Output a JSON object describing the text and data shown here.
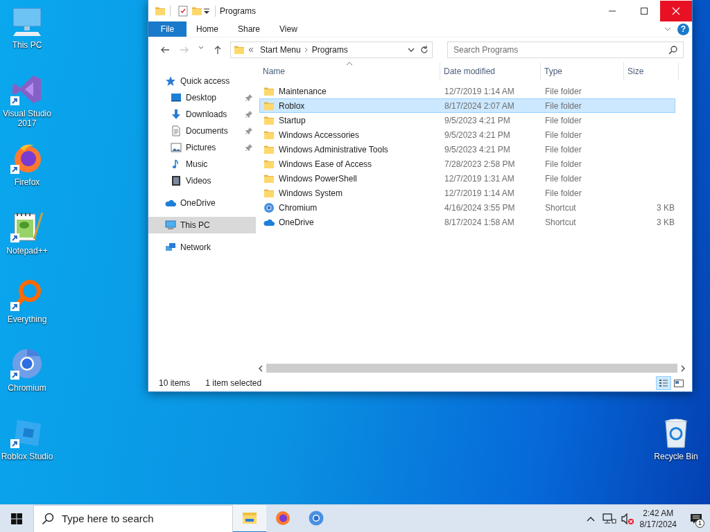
{
  "desktop_icons": [
    {
      "label": "This PC",
      "kind": "pc",
      "shortcut": false
    },
    {
      "label": "Visual Studio 2017",
      "kind": "vs",
      "shortcut": true
    },
    {
      "label": "Firefox",
      "kind": "firefox",
      "shortcut": true
    },
    {
      "label": "Notepad++",
      "kind": "notepad",
      "shortcut": true
    },
    {
      "label": "Everything",
      "kind": "everything",
      "shortcut": true
    },
    {
      "label": "Chromium",
      "kind": "chromium",
      "shortcut": true
    },
    {
      "label": "Roblox Studio",
      "kind": "roblox",
      "shortcut": true
    }
  ],
  "recycle_bin": {
    "label": "Recycle Bin"
  },
  "window": {
    "title": "Programs",
    "ribbon_tabs": [
      {
        "label": "File",
        "kind": "file"
      },
      {
        "label": "Home",
        "kind": "tab"
      },
      {
        "label": "Share",
        "kind": "tab"
      },
      {
        "label": "View",
        "kind": "tab"
      }
    ],
    "help": "?",
    "nav_buttons": [
      {
        "kind": "back",
        "disabled": false
      },
      {
        "kind": "forward",
        "disabled": true
      },
      {
        "kind": "recent",
        "disabled": false
      },
      {
        "kind": "up",
        "disabled": false
      }
    ],
    "breadcrumb": [
      "Start Menu",
      "Programs"
    ],
    "search": {
      "placeholder": "Search Programs"
    },
    "nav_pane": [
      {
        "label": "Quick access",
        "kind": "star",
        "selected": false,
        "children": [
          {
            "label": "Desktop",
            "kind": "desktop",
            "pinned": true,
            "selected": false
          },
          {
            "label": "Downloads",
            "kind": "download",
            "pinned": true,
            "selected": false
          },
          {
            "label": "Documents",
            "kind": "document",
            "pinned": true,
            "selected": false
          },
          {
            "label": "Pictures",
            "kind": "picture",
            "pinned": true,
            "selected": false
          },
          {
            "label": "Music",
            "kind": "music",
            "pinned": false,
            "selected": false
          },
          {
            "label": "Videos",
            "kind": "video",
            "pinned": false,
            "selected": false
          }
        ]
      },
      {
        "label": "OneDrive",
        "kind": "onedrive",
        "selected": false
      },
      {
        "label": "This PC",
        "kind": "pc",
        "selected": true
      },
      {
        "label": "Network",
        "kind": "network",
        "selected": false
      }
    ],
    "columns": [
      {
        "label": "Name",
        "sorted": true
      },
      {
        "label": "Date modified",
        "sorted": false
      },
      {
        "label": "Type",
        "sorted": false
      },
      {
        "label": "Size",
        "sorted": false
      }
    ],
    "rows": [
      {
        "name": "Maintenance",
        "date": "12/7/2019 1:14 AM",
        "type": "File folder",
        "kind": "folder",
        "selected": false
      },
      {
        "name": "Roblox",
        "date": "8/17/2024 2:07 AM",
        "type": "File folder",
        "kind": "folder",
        "selected": true
      },
      {
        "name": "Startup",
        "date": "9/5/2023 4:21 PM",
        "type": "File folder",
        "kind": "folder",
        "selected": false
      },
      {
        "name": "Windows Accessories",
        "date": "9/5/2023 4:21 PM",
        "type": "File folder",
        "kind": "folder",
        "selected": false
      },
      {
        "name": "Windows Administrative Tools",
        "date": "9/5/2023 4:21 PM",
        "type": "File folder",
        "kind": "folder",
        "selected": false
      },
      {
        "name": "Windows Ease of Access",
        "date": "7/28/2023 2:58 PM",
        "type": "File folder",
        "kind": "folder",
        "selected": false
      },
      {
        "name": "Windows PowerShell",
        "date": "12/7/2019 1:31 AM",
        "type": "File folder",
        "kind": "folder",
        "selected": false
      },
      {
        "name": "Windows System",
        "date": "12/7/2019 1:14 AM",
        "type": "File folder",
        "kind": "folder",
        "selected": false
      },
      {
        "name": "Chromium",
        "date": "4/16/2024 3:55 PM",
        "type": "Shortcut",
        "size": "3 KB",
        "kind": "chromium",
        "selected": false
      },
      {
        "name": "OneDrive",
        "date": "8/17/2024 1:58 AM",
        "type": "Shortcut",
        "size": "3 KB",
        "kind": "onedrive",
        "selected": false
      }
    ],
    "status": {
      "count": "10 items",
      "selection": "1 item selected"
    },
    "view_modes": [
      {
        "kind": "details",
        "selected": true
      },
      {
        "kind": "tiles",
        "selected": false
      }
    ]
  },
  "taskbar": {
    "search": {
      "placeholder": "Type here to search"
    },
    "apps": [
      {
        "kind": "explorer",
        "active": true
      },
      {
        "kind": "firefox",
        "active": false
      },
      {
        "kind": "chromium",
        "active": false
      }
    ],
    "time": "2:42 AM",
    "date": "8/17/2024",
    "notifications": "1"
  }
}
